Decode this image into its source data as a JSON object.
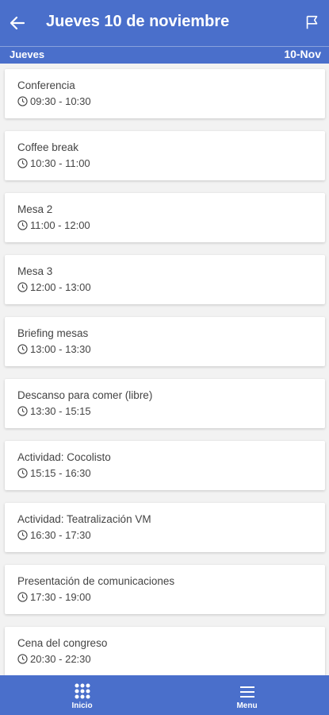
{
  "header": {
    "title": "Jueves 10 de noviembre",
    "back_icon": "arrow-left-icon",
    "flag_icon": "flag-icon"
  },
  "day_bar": {
    "day": "Jueves",
    "date": "10-Nov"
  },
  "events": [
    {
      "name": "Conferencia",
      "time": "09:30 - 10:30"
    },
    {
      "name": "Coffee break",
      "time": "10:30 - 11:00"
    },
    {
      "name": "Mesa 2",
      "time": "11:00 - 12:00"
    },
    {
      "name": "Mesa 3",
      "time": "12:00 - 13:00"
    },
    {
      "name": "Briefing mesas",
      "time": "13:00 - 13:30"
    },
    {
      "name": "Descanso para comer (libre)",
      "time": "13:30 - 15:15"
    },
    {
      "name": "Actividad: Cocolisto",
      "time": "15:15 - 16:30"
    },
    {
      "name": "Actividad: Teatralización VM",
      "time": "16:30 - 17:30"
    },
    {
      "name": "Presentación de comunicaciones",
      "time": "17:30 - 19:00"
    },
    {
      "name": "Cena del congreso",
      "time": "20:30 - 22:30"
    }
  ],
  "bottom_nav": [
    {
      "label": "Inicio",
      "icon": "grid-icon"
    },
    {
      "label": "Menu",
      "icon": "hamburger-menu-icon"
    }
  ],
  "colors": {
    "primary": "#4a6fcb",
    "background": "#f2f2f2",
    "card": "#ffffff",
    "text": "#444444"
  }
}
